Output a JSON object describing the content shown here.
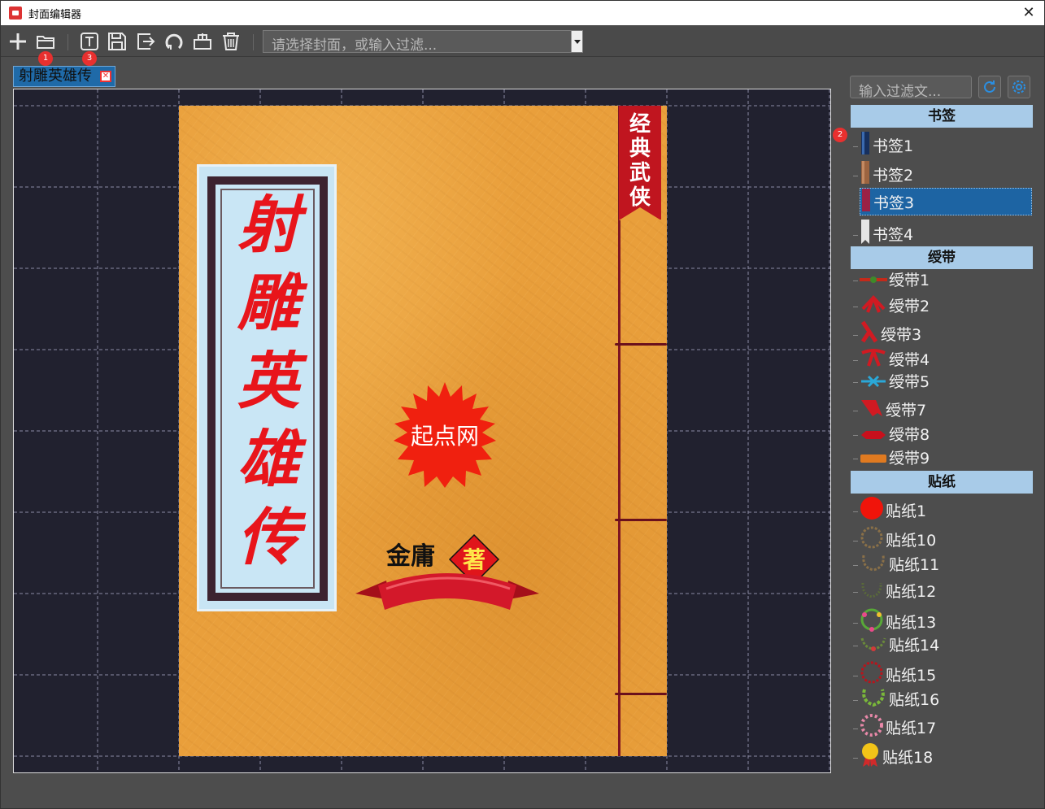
{
  "window": {
    "title": "封面编辑器",
    "close_glyph": "✕"
  },
  "toolbar": {
    "buttons": [
      {
        "name": "new",
        "icon": "plus-icon"
      },
      {
        "name": "open",
        "icon": "folder-open-icon"
      },
      {
        "name": "text",
        "icon": "text-box-icon"
      },
      {
        "name": "save",
        "icon": "floppy-icon"
      },
      {
        "name": "export",
        "icon": "export-icon"
      },
      {
        "name": "reset",
        "icon": "refresh-icon"
      },
      {
        "name": "basket",
        "icon": "basket-icon"
      },
      {
        "name": "delete",
        "icon": "trash-icon"
      }
    ],
    "badges": [
      "1",
      "3",
      "2"
    ],
    "combo_placeholder": "请选择封面，或输入过滤..."
  },
  "tab": {
    "label": "射雕英雄传",
    "close_glyph": "✕"
  },
  "cover": {
    "title_chars": [
      "射",
      "雕",
      "英",
      "雄",
      "传"
    ],
    "ribbon_chars": [
      "经",
      "典",
      "武",
      "侠"
    ],
    "stamp_text": "起点网",
    "author_text": "金庸",
    "author_suffix": "著",
    "colors": {
      "paper": "#e99f3b",
      "title": "#e8151b",
      "ribbon": "#c0151f",
      "thread": "#7e1421"
    }
  },
  "side": {
    "filter_placeholder": "输入过滤文...",
    "refresh_icon": "refresh-icon",
    "settings_icon": "gear-icon",
    "groups": [
      {
        "title": "书签",
        "items": [
          "书签1",
          "书签2",
          "书签3",
          "书签4"
        ],
        "selected": "书签3"
      },
      {
        "title": "绶带",
        "items": [
          "绶带1",
          "绶带2",
          "绶带3",
          "绶带4",
          "绶带5",
          "绶带7",
          "绶带8",
          "绶带9"
        ]
      },
      {
        "title": "贴纸",
        "items": [
          "贴纸1",
          "贴纸10",
          "贴纸11",
          "贴纸12",
          "贴纸13",
          "贴纸14",
          "贴纸15",
          "贴纸16",
          "贴纸17",
          "贴纸18"
        ]
      }
    ]
  }
}
